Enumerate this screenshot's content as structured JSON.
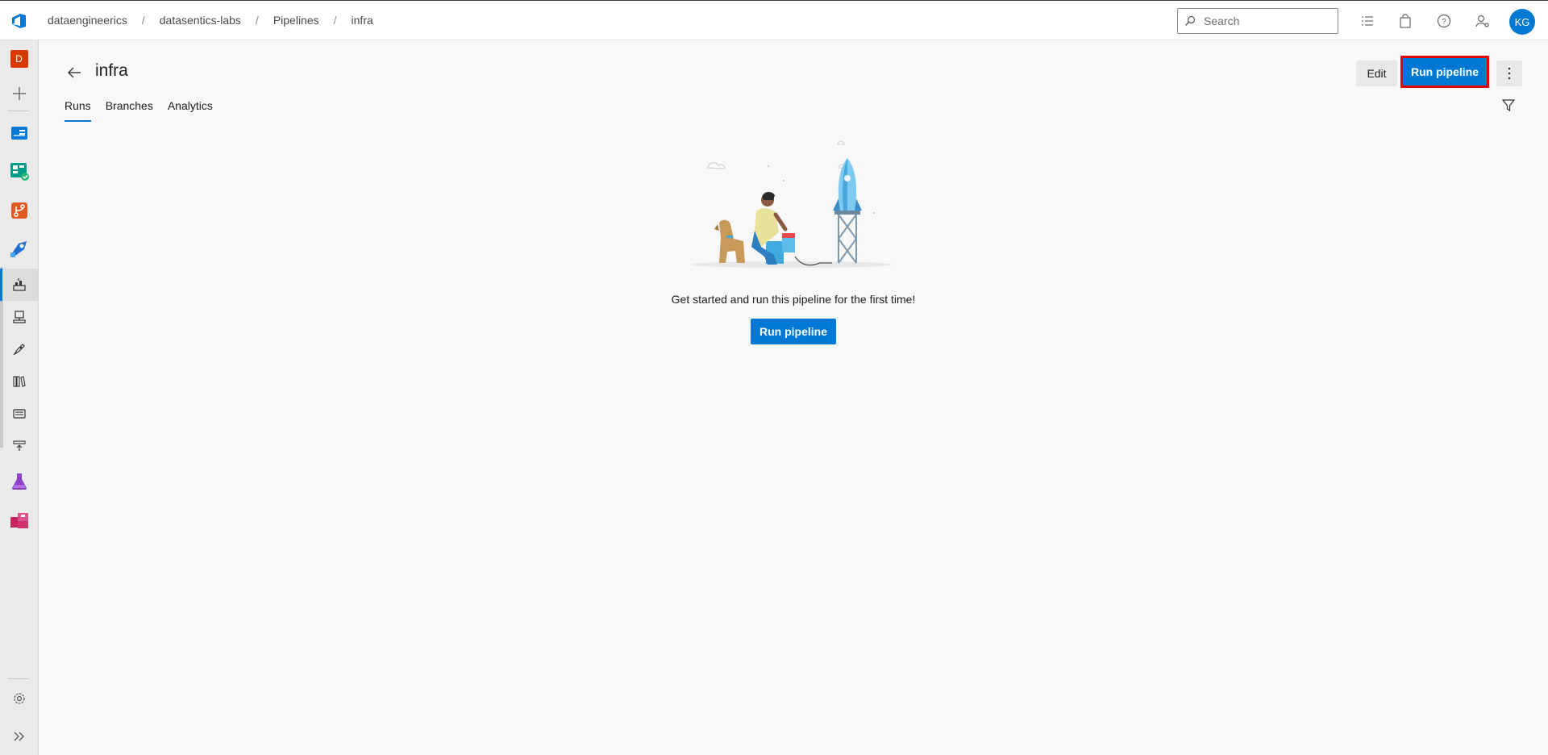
{
  "topbar": {
    "breadcrumbs": [
      "dataengineerics",
      "datasentics-labs",
      "Pipelines",
      "infra"
    ],
    "separator": "/",
    "search_placeholder": "Search",
    "avatar_initials": "KG"
  },
  "rail": {
    "project_initial": "D",
    "items": [
      {
        "icon": "add-icon"
      },
      {
        "icon": "overview-icon"
      },
      {
        "icon": "boards-icon"
      },
      {
        "icon": "repos-icon"
      },
      {
        "icon": "pipelines-icon"
      },
      {
        "icon": "pipelines-sub-icon",
        "active": true
      },
      {
        "icon": "environments-icon"
      },
      {
        "icon": "releases-icon"
      },
      {
        "icon": "library-icon"
      },
      {
        "icon": "task-groups-icon"
      },
      {
        "icon": "deployment-groups-icon"
      },
      {
        "icon": "test-plans-icon"
      },
      {
        "icon": "artifacts-icon"
      }
    ],
    "settings_icon": "gear-icon",
    "collapse_icon": "expand-chevron-icon"
  },
  "page": {
    "title": "infra",
    "edit_label": "Edit",
    "run_label": "Run pipeline",
    "tabs": [
      {
        "label": "Runs",
        "active": true
      },
      {
        "label": "Branches"
      },
      {
        "label": "Analytics"
      }
    ]
  },
  "empty_state": {
    "message": "Get started and run this pipeline for the first time!",
    "button_label": "Run pipeline"
  },
  "colors": {
    "accent": "#0078d4",
    "highlight": "#e60000",
    "project_badge": "#d83b01"
  }
}
